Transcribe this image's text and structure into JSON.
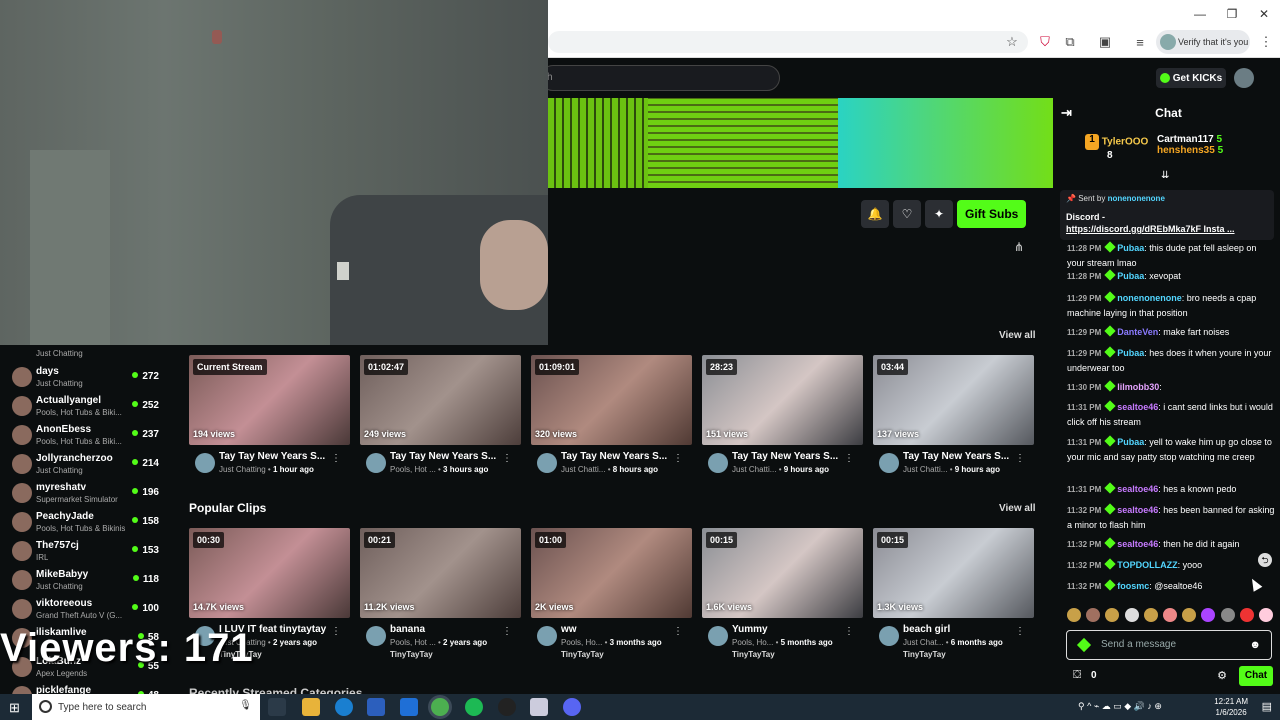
{
  "browser": {
    "verify_label": "Verify that it's you"
  },
  "site": {
    "search_placeholder": "h",
    "get_kicks_label": "Get KICKs",
    "gift_subs_label": "Gift Subs"
  },
  "overlay": {
    "viewers_text": "Viewers: 171"
  },
  "sidebar": {
    "items": [
      {
        "name": "",
        "category": "Just Chatting",
        "viewers": ""
      },
      {
        "name": "days",
        "category": "Just Chatting",
        "viewers": "272"
      },
      {
        "name": "Actuallyangel",
        "category": "Pools, Hot Tubs & Biki...",
        "viewers": "252"
      },
      {
        "name": "AnonEbess",
        "category": "Pools, Hot Tubs & Biki...",
        "viewers": "237"
      },
      {
        "name": "Jollyrancherzoo",
        "category": "Just Chatting",
        "viewers": "214"
      },
      {
        "name": "myreshatv",
        "category": "Supermarket Simulator",
        "viewers": "196"
      },
      {
        "name": "PeachyJade",
        "category": "Pools, Hot Tubs & Bikinis",
        "viewers": "158"
      },
      {
        "name": "The757cj",
        "category": "IRL",
        "viewers": "153"
      },
      {
        "name": "MikeBabyy",
        "category": "Just Chatting",
        "viewers": "118"
      },
      {
        "name": "viktoreeous",
        "category": "Grand Theft Auto V (G...",
        "viewers": "100"
      },
      {
        "name": "iliskamlive",
        "category": "",
        "viewers": "58"
      },
      {
        "name": "LolaBunz",
        "category": "Apex Legends",
        "viewers": "55"
      },
      {
        "name": "picklefange",
        "category": "",
        "viewers": "48"
      }
    ]
  },
  "videos": {
    "view_all_label": "View all",
    "items": [
      {
        "tag": "Current Stream",
        "views": "194 views",
        "title": "Tay Tay New Years S...",
        "category": "Just Chatting",
        "age": "1 hour ago"
      },
      {
        "tag": "01:02:47",
        "views": "249 views",
        "title": "Tay Tay New Years S...",
        "category": "Pools, Hot ...",
        "age": "3 hours ago"
      },
      {
        "tag": "01:09:01",
        "views": "320 views",
        "title": "Tay Tay New Years S...",
        "category": "Just Chatti...",
        "age": "8 hours ago"
      },
      {
        "tag": "28:23",
        "views": "151 views",
        "title": "Tay Tay New Years S...",
        "category": "Just Chatti...",
        "age": "9 hours ago"
      },
      {
        "tag": "03:44",
        "views": "137 views",
        "title": "Tay Tay New Years S...",
        "category": "Just Chatti...",
        "age": "9 hours ago"
      }
    ]
  },
  "clips": {
    "title": "Popular Clips",
    "view_all_label": "View all",
    "items": [
      {
        "tag": "00:30",
        "views": "14.7K views",
        "title": "I LUV IT feat tinytaytay",
        "category": "Just Chatting",
        "age": "2 years ago",
        "channel": "TinyTayTay"
      },
      {
        "tag": "00:21",
        "views": "11.2K views",
        "title": "banana",
        "category": "Pools, Hot ...",
        "age": "2 years ago",
        "channel": "TinyTayTay"
      },
      {
        "tag": "01:00",
        "views": "2K views",
        "title": "ww",
        "category": "Pools, Ho...",
        "age": "3 months ago",
        "channel": "TinyTayTay"
      },
      {
        "tag": "00:15",
        "views": "1.6K views",
        "title": "Yummy",
        "category": "Pools, Ho...",
        "age": "5 months ago",
        "channel": "TinyTayTay"
      },
      {
        "tag": "00:15",
        "views": "1.3K views",
        "title": "beach girl",
        "category": "Just Chat...",
        "age": "6 months ago",
        "channel": "TinyTayTay"
      }
    ]
  },
  "bottom_section": "Recently Streamed Categories",
  "chat": {
    "title": "Chat",
    "gifters": [
      {
        "name": "TylerOOO",
        "count": "8"
      },
      {
        "name": "Cartman117",
        "count": "5"
      },
      {
        "name": "henshens35",
        "count": "5"
      }
    ],
    "pinned": {
      "sent_by_label": "Sent by",
      "sender": "nonenonenone",
      "text": "Discord - ",
      "link": "https://discord.gg/dREbMka7kF Insta ..."
    },
    "messages": [
      {
        "time": "11:28 PM",
        "user": "Pubaa",
        "color": "#53d6ff",
        "text": ": this dude pat fell asleep on your stream lmao"
      },
      {
        "time": "11:28 PM",
        "user": "Pubaa",
        "color": "#53d6ff",
        "text": ": xevopat"
      },
      {
        "time": "11:29 PM",
        "user": "nonenonenone",
        "color": "#53d6ff",
        "text": ": bro needs a cpap machine laying in that position"
      },
      {
        "time": "11:29 PM",
        "user": "DanteVen",
        "color": "#8b7bff",
        "text": ": make fart noises"
      },
      {
        "time": "11:29 PM",
        "user": "Pubaa",
        "color": "#53d6ff",
        "text": ": hes does it when youre in your underwear too"
      },
      {
        "time": "11:30 PM",
        "user": "lilmobb30",
        "color": "#e6a4ff",
        "text": ":"
      },
      {
        "time": "11:31 PM",
        "user": "sealtoe46",
        "color": "#c77bff",
        "text": ": i cant send links but i would click off his stream"
      },
      {
        "time": "11:31 PM",
        "user": "Pubaa",
        "color": "#53d6ff",
        "text": ": yell to wake him up go close to your mic and say patty stop watching me creep"
      },
      {
        "time": "11:31 PM",
        "user": "sealtoe46",
        "color": "#c77bff",
        "text": ": hes a known pedo"
      },
      {
        "time": "11:32 PM",
        "user": "sealtoe46",
        "color": "#c77bff",
        "text": ": hes been banned for asking a minor to flash him"
      },
      {
        "time": "11:32 PM",
        "user": "sealtoe46",
        "color": "#c77bff",
        "text": ": then he did it again"
      },
      {
        "time": "11:32 PM",
        "user": "TOPDOLLAZZ",
        "color": "#53d6ff",
        "text": ": yooo"
      },
      {
        "time": "11:32 PM",
        "user": "foosmc",
        "color": "#53d6ff",
        "text": ": @sealtoe46"
      }
    ],
    "input_placeholder": "Send a message",
    "kicks_count": "0",
    "chat_button": "Chat"
  },
  "taskbar": {
    "search_placeholder": "Type here to search",
    "time": "12:21 AM",
    "date": "1/6/2026"
  }
}
